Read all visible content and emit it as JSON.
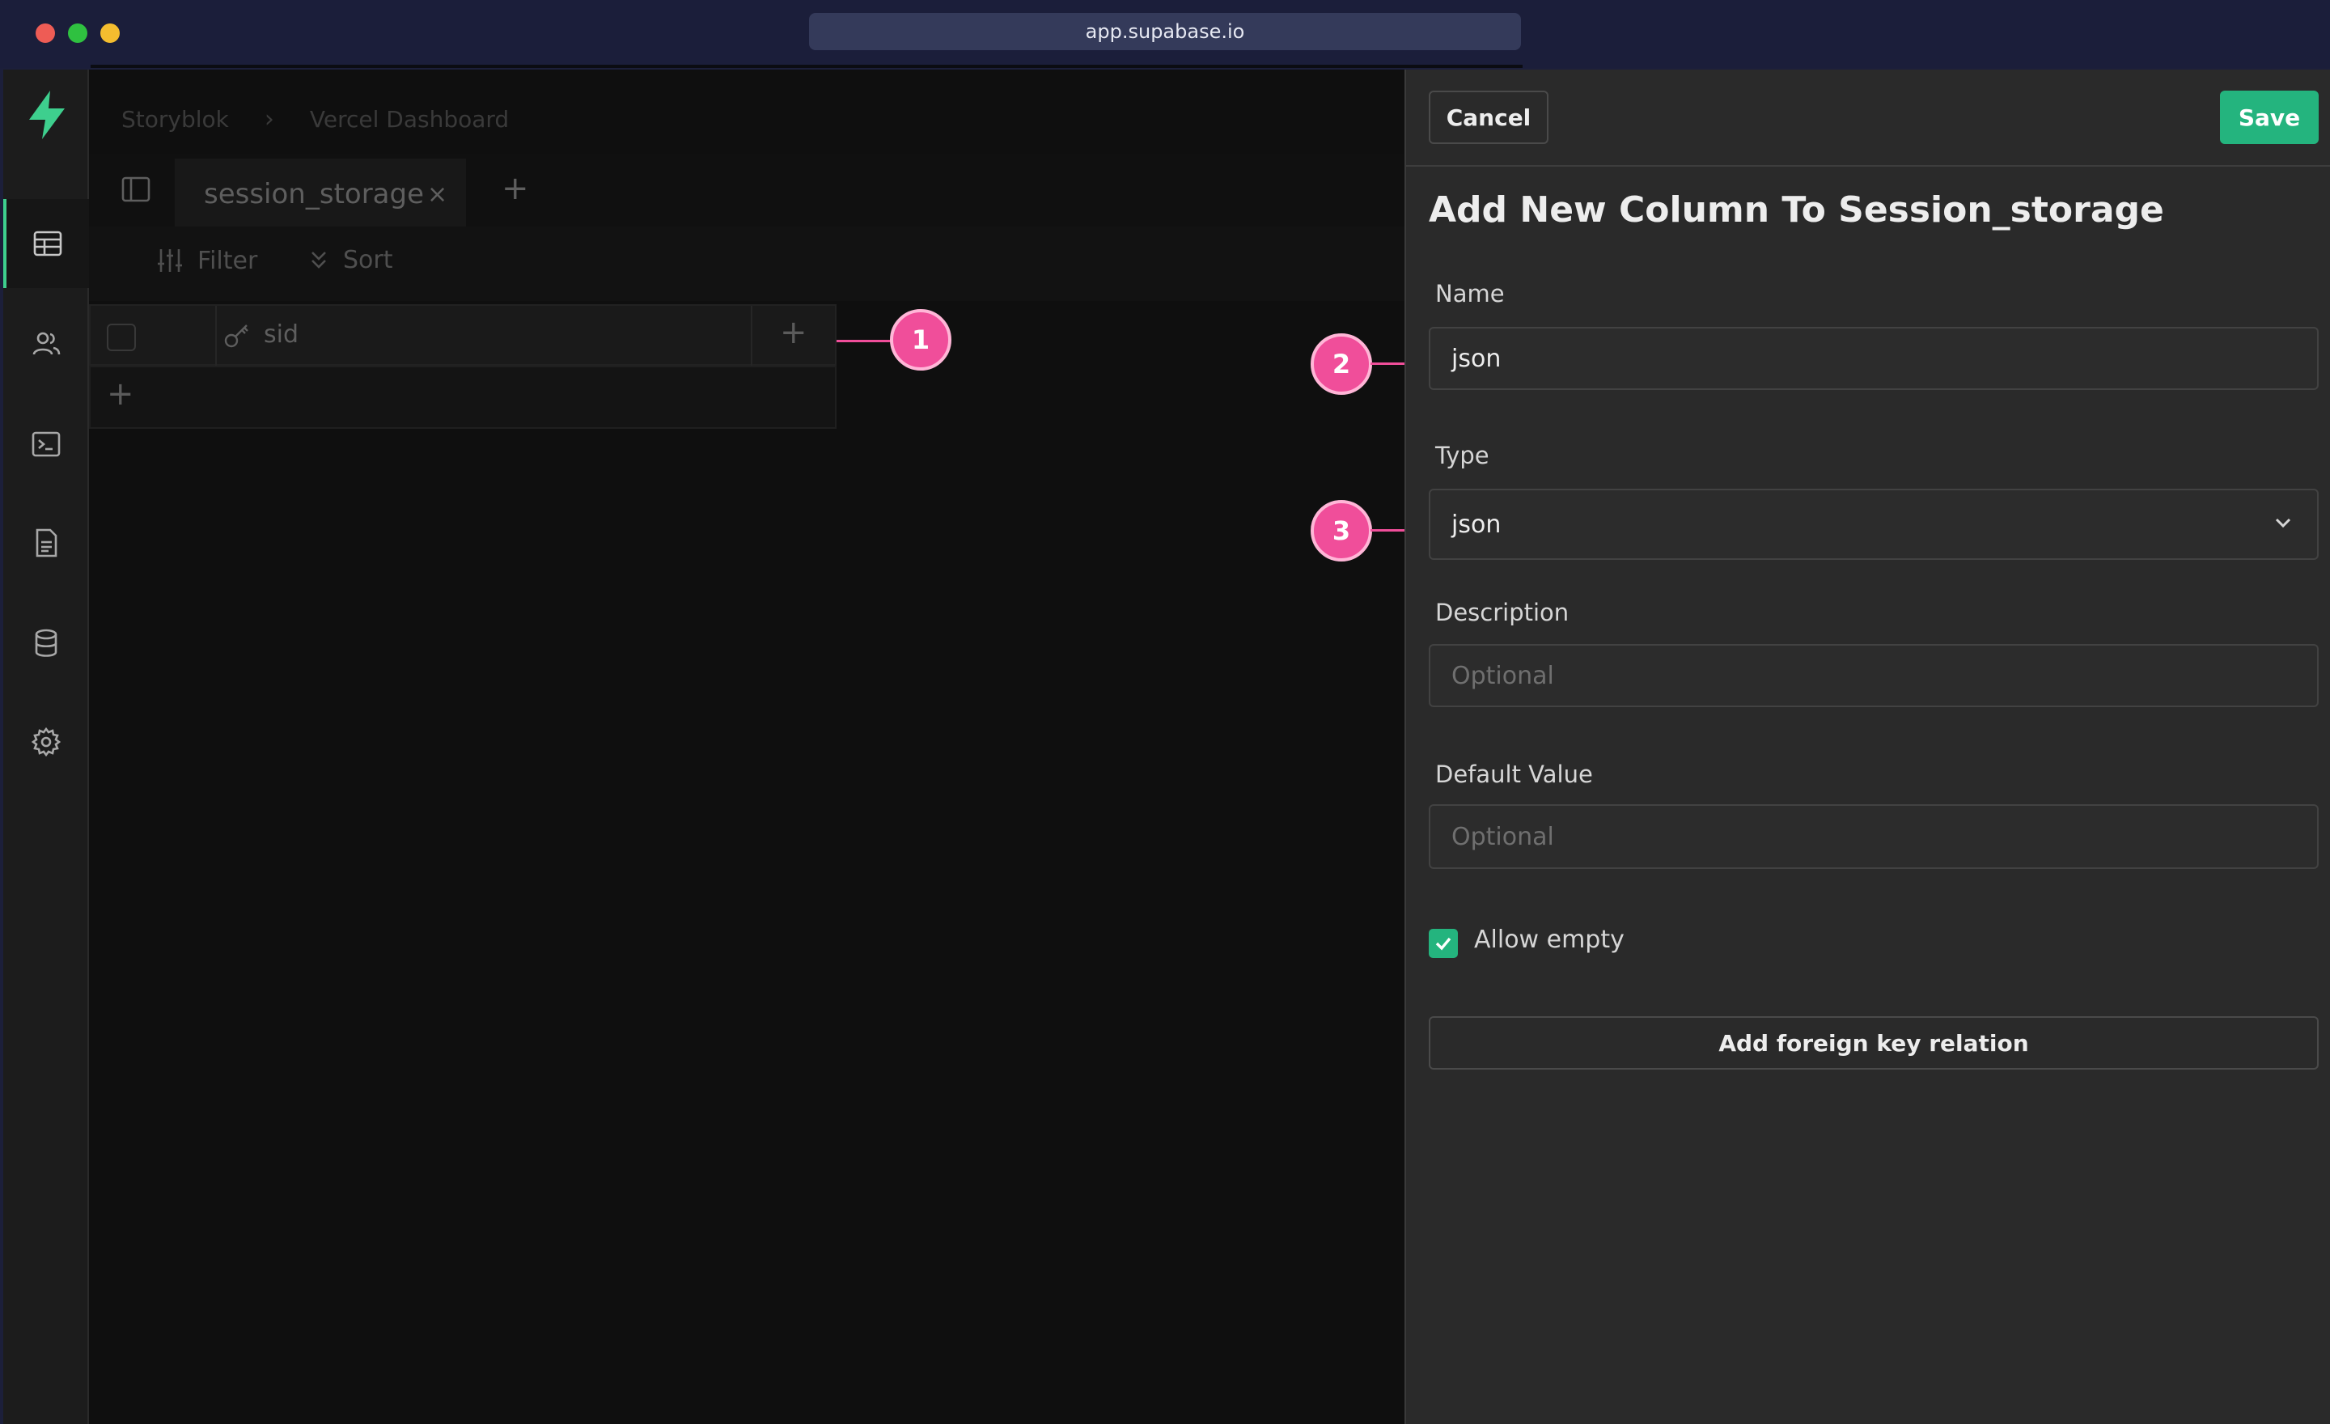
{
  "browser": {
    "url": "app.supabase.io"
  },
  "breadcrumb": {
    "project": "Storyblok",
    "item": "Vercel Dashboard"
  },
  "tabs": {
    "active_label": "session_storage",
    "close_glyph": "×",
    "add_glyph": "+"
  },
  "toolbar": {
    "filter_label": "Filter",
    "sort_label": "Sort"
  },
  "grid": {
    "columns": [
      "sid"
    ],
    "add_column_glyph": "+",
    "add_row_glyph": "+"
  },
  "nav": {
    "items": [
      "table-editor-icon",
      "users-icon",
      "terminal-icon",
      "document-icon",
      "database-icon",
      "settings-icon"
    ],
    "accent": "#3ecf8e"
  },
  "markers": [
    "1",
    "2",
    "3"
  ],
  "panel": {
    "cancel_label": "Cancel",
    "save_label": "Save",
    "title": "Add New Column To Session_storage",
    "name_label": "Name",
    "name_value": "json",
    "type_label": "Type",
    "type_value": "json",
    "description_label": "Description",
    "description_placeholder": "Optional",
    "default_label": "Default Value",
    "default_placeholder": "Optional",
    "allow_empty_label": "Allow empty",
    "allow_empty_checked": true,
    "foreign_key_label": "Add foreign key relation"
  },
  "colors": {
    "save": "#24b47e",
    "marker": "#f04e9a"
  }
}
